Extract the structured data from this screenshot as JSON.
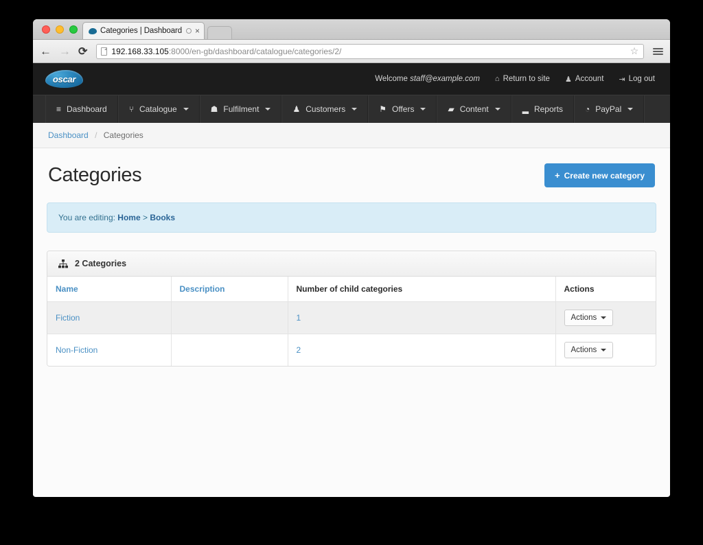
{
  "browser": {
    "tab_title": "Categories | Dashboard | O",
    "tab_close_label": "×",
    "back_label": "←",
    "forward_label": "→",
    "reload_label": "⟳",
    "url_host": "192.168.33.105",
    "url_rest": ":8000/en-gb/dashboard/catalogue/categories/2/",
    "star_label": "☆"
  },
  "topbar": {
    "logo_text": "oscar",
    "welcome_prefix": "Welcome ",
    "welcome_user": "staff@example.com",
    "links": [
      {
        "label": "Return to site",
        "icon": "⌂"
      },
      {
        "label": "Account",
        "icon": "♟"
      },
      {
        "label": "Log out",
        "icon": "⇥"
      }
    ]
  },
  "mainnav": {
    "items": [
      {
        "label": "Dashboard",
        "icon": "≡",
        "caret": false
      },
      {
        "label": "Catalogue",
        "icon": "⑂",
        "caret": true
      },
      {
        "label": "Fulfilment",
        "icon": "☗",
        "caret": true
      },
      {
        "label": "Customers",
        "icon": "♟",
        "caret": true
      },
      {
        "label": "Offers",
        "icon": "⚑",
        "caret": true
      },
      {
        "label": "Content",
        "icon": "▰",
        "caret": true
      },
      {
        "label": "Reports",
        "icon": "▂",
        "caret": false
      },
      {
        "label": "PayPal",
        "icon": "◔",
        "caret": true
      }
    ]
  },
  "breadcrumb": {
    "root_label": "Dashboard",
    "separator": "/",
    "current_label": "Categories"
  },
  "page": {
    "title": "Categories",
    "create_button_label": "Create new category",
    "create_button_plus": "+",
    "create_button_color": "#3a8ed0"
  },
  "alert": {
    "prefix": "You are editing: ",
    "link_home": "Home",
    "separator": " > ",
    "link_books": "Books",
    "bg_color": "#d9edf7",
    "text_color": "#31708f"
  },
  "panel": {
    "heading": "2 Categories",
    "heading_icon": "sitemap-icon"
  },
  "table": {
    "columns": [
      {
        "label": "Name",
        "link": true
      },
      {
        "label": "Description",
        "link": true
      },
      {
        "label": "Number of child categories",
        "link": false
      },
      {
        "label": "Actions",
        "link": false
      }
    ],
    "rows": [
      {
        "name": "Fiction",
        "description": "",
        "children": "1",
        "action_label": "Actions"
      },
      {
        "name": "Non-Fiction",
        "description": "",
        "children": "2",
        "action_label": "Actions"
      }
    ]
  }
}
